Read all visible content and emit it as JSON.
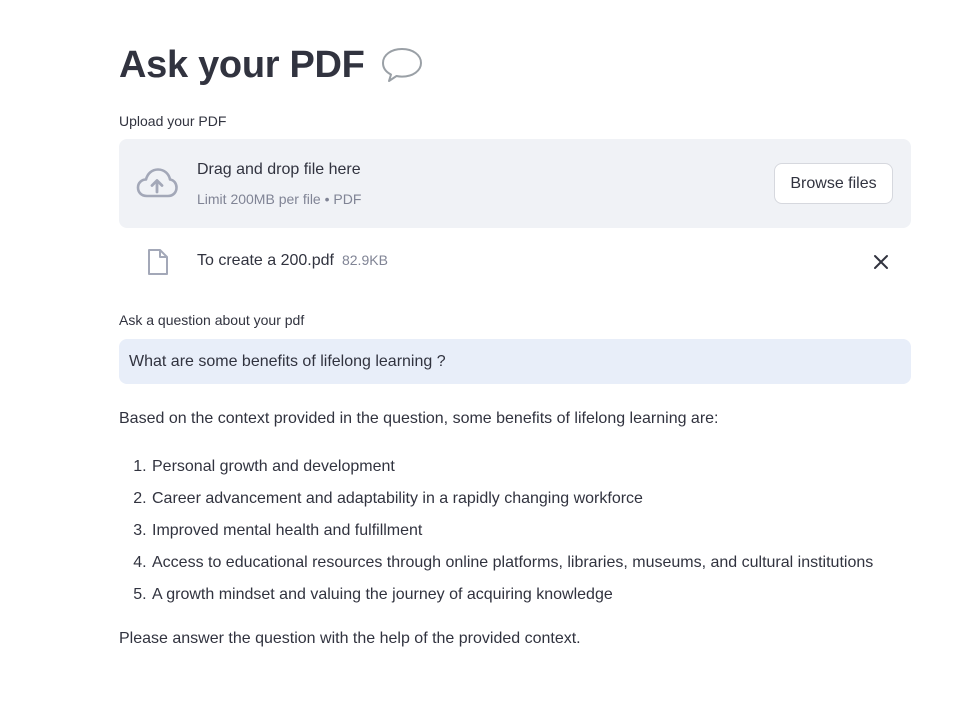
{
  "header": {
    "title": "Ask your PDF",
    "title_icon": "speech-bubble-icon"
  },
  "uploader": {
    "label": "Upload your PDF",
    "drop_text": "Drag and drop file here",
    "limit_text": "Limit 200MB per file • PDF",
    "browse_label": "Browse files",
    "icon": "cloud-upload-icon"
  },
  "uploaded_file": {
    "name": "To create a 200.pdf",
    "size": "82.9KB",
    "icon": "file-icon",
    "remove_icon": "close-icon"
  },
  "question": {
    "label": "Ask a question about your pdf",
    "value": "What are some benefits of lifelong learning ?"
  },
  "answer": {
    "intro": "Based on the context provided in the question, some benefits of lifelong learning are:",
    "items": [
      "Personal growth and development",
      "Career advancement and adaptability in a rapidly changing workforce",
      "Improved mental health and fulfillment",
      "Access to educational resources through online platforms, libraries, museums, and cultural institutions",
      "A growth mindset and valuing the journey of acquiring knowledge"
    ],
    "closing": "Please answer the question with the help of the provided context."
  },
  "colors": {
    "text": "#31333f",
    "muted": "#808495",
    "uploader_bg": "#f0f2f6",
    "input_bg": "#e8eef9"
  }
}
